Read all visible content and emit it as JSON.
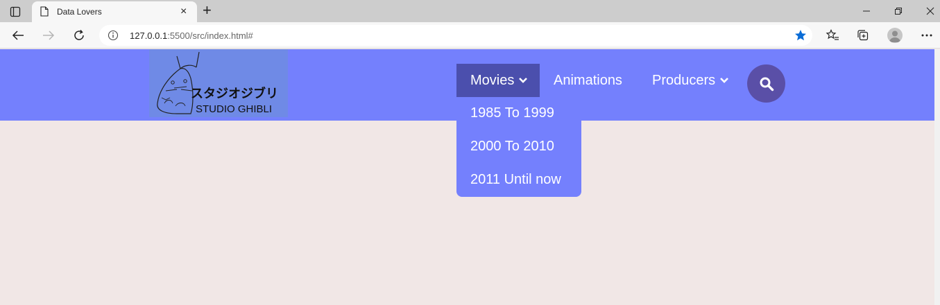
{
  "browser": {
    "tab_title": "Data Lovers",
    "url_host": "127.0.0.1",
    "url_rest": ":5500/src/index.html#",
    "accent_color": "#0a6cd6"
  },
  "site": {
    "logo_alt": "スタジオジブリ STUDIO GHIBLI",
    "logo_jp": "スタジオジブリ",
    "logo_en": "STUDIO GHIBLI",
    "header_color": "#7480fd",
    "active_nav_color": "#4b4fad",
    "search_btn_color": "#5a4fa7",
    "background_color": "#f1e7e6",
    "nav": {
      "movies": "Movies",
      "animations": "Animations",
      "producers": "Producers"
    },
    "dropdown": {
      "items": [
        "1985 To 1999",
        "2000 To 2010",
        "2011 Until now"
      ]
    }
  }
}
